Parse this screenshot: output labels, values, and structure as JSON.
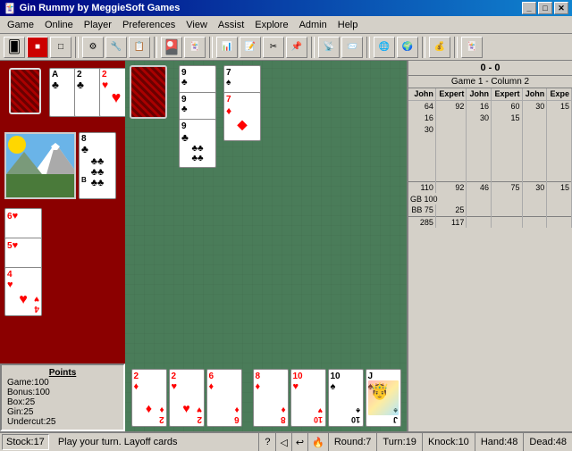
{
  "window": {
    "title": "Gin Rummy by MeggieSoft Games",
    "icon": "🃏"
  },
  "titlebar": {
    "minimize_label": "_",
    "maximize_label": "□",
    "close_label": "✕"
  },
  "menu": {
    "items": [
      "Game",
      "Online",
      "Player",
      "Preferences",
      "View",
      "Assist",
      "Explore",
      "Admin",
      "Help"
    ]
  },
  "score": {
    "header": "0 - 0",
    "game_col": "Game 1 - Column 2",
    "col_headers": [
      "John",
      "Expert",
      "John",
      "Expert",
      "John",
      "Expe"
    ],
    "rows": [
      [
        "64",
        "92",
        "16",
        "60",
        "30",
        "15"
      ],
      [
        "16",
        "",
        "30",
        "15",
        ""
      ],
      [
        "30",
        ""
      ],
      [
        "",
        ""
      ],
      [
        "",
        ""
      ],
      [
        "110",
        "92",
        "46",
        "75",
        "30",
        "15"
      ],
      [
        "GB 100",
        "",
        "",
        "",
        "",
        ""
      ],
      [
        "BB 75",
        "25",
        "",
        "",
        "",
        ""
      ],
      [
        "285",
        "117",
        "",
        "",
        "",
        ""
      ]
    ]
  },
  "points": {
    "title": "Points",
    "items": [
      {
        "label": "Game:",
        "value": "100"
      },
      {
        "label": "Bonus:",
        "value": "100"
      },
      {
        "label": "Box:",
        "value": "25"
      },
      {
        "label": "Gin:",
        "value": "25"
      },
      {
        "label": "Undercut:",
        "value": "25"
      }
    ]
  },
  "status": {
    "stock": "Stock:17",
    "message": "Play your turn. Layoff cards",
    "help": "?",
    "nav1": "◁",
    "undo": "↩",
    "fire_icon": "🔥",
    "round": "Round:7",
    "turn": "Turn:19",
    "knock": "Knock:10",
    "hand": "Hand:48",
    "dead": "Dead:48"
  },
  "toolbar": {
    "buttons": [
      "📁",
      "💾",
      "🖨",
      "⚙",
      "🔧",
      "📋",
      "✂",
      "📌",
      "🔍",
      "🎯",
      "📊",
      "🎮",
      "🎲",
      "📡",
      "📨",
      "📬",
      "🌐",
      "💰",
      "🃏"
    ]
  }
}
